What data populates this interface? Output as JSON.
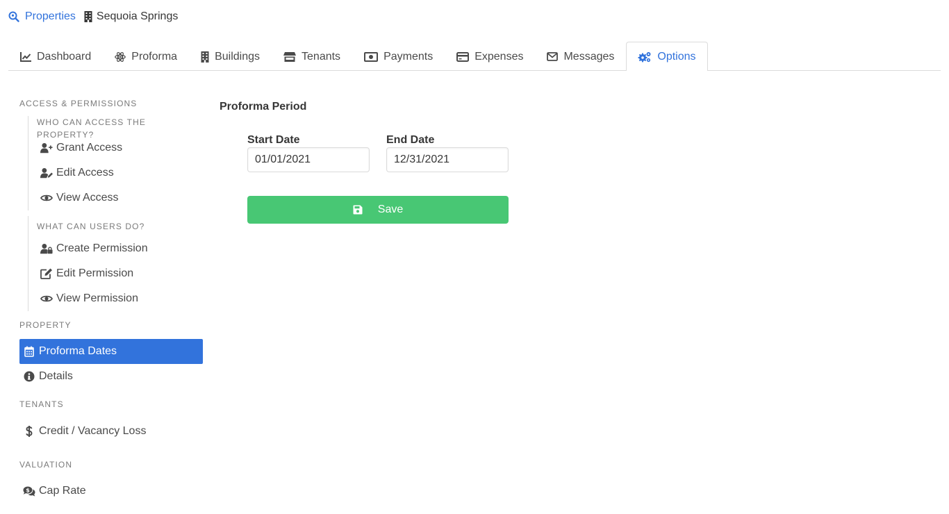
{
  "breadcrumb": {
    "root": {
      "label": "Properties",
      "icon": "search-location-icon"
    },
    "current": {
      "label": "Sequoia Springs",
      "icon": "building-icon"
    }
  },
  "tabs": [
    {
      "label": "Dashboard",
      "icon": "chart-line-icon",
      "active": false
    },
    {
      "label": "Proforma",
      "icon": "react-atom-icon",
      "active": false
    },
    {
      "label": "Buildings",
      "icon": "building-icon",
      "active": false
    },
    {
      "label": "Tenants",
      "icon": "store-icon",
      "active": false
    },
    {
      "label": "Payments",
      "icon": "money-bill-icon",
      "active": false
    },
    {
      "label": "Expenses",
      "icon": "credit-card-icon",
      "active": false
    },
    {
      "label": "Messages",
      "icon": "envelope-icon",
      "active": false
    },
    {
      "label": "Options",
      "icon": "cogs-icon",
      "active": true
    }
  ],
  "menu": {
    "access_label": "Access & Permissions",
    "who_label": "Who can access the property?",
    "who_items": [
      {
        "label": "Grant Access",
        "icon": "user-plus-icon"
      },
      {
        "label": "Edit Access",
        "icon": "user-edit-icon"
      },
      {
        "label": "View Access",
        "icon": "eye-icon"
      }
    ],
    "what_label": "What can users do?",
    "what_items": [
      {
        "label": "Create Permission",
        "icon": "user-lock-icon"
      },
      {
        "label": "Edit Permission",
        "icon": "edit-icon"
      },
      {
        "label": "View Permission",
        "icon": "eye-icon"
      }
    ],
    "property_label": "Property",
    "property_items": [
      {
        "label": "Proforma Dates",
        "icon": "calendar-icon",
        "active": true
      },
      {
        "label": "Details",
        "icon": "info-circle-icon",
        "active": false
      }
    ],
    "tenants_label": "Tenants",
    "tenants_items": [
      {
        "label": "Credit / Vacancy Loss",
        "icon": "dollar-sign-icon"
      }
    ],
    "valuation_label": "Valuation",
    "valuation_items": [
      {
        "label": "Cap Rate",
        "icon": "comments-dollar-icon"
      }
    ]
  },
  "form": {
    "title": "Proforma Period",
    "start_label": "Start Date",
    "start_value": "01/01/2021",
    "end_label": "End Date",
    "end_value": "12/31/2021",
    "save_label": "Save"
  },
  "colors": {
    "link": "#3273dc",
    "active_bg": "#3273dc",
    "save_bg": "#48c774",
    "text": "#363636",
    "muted": "#7a7a7a",
    "border": "#dbdbdb"
  }
}
